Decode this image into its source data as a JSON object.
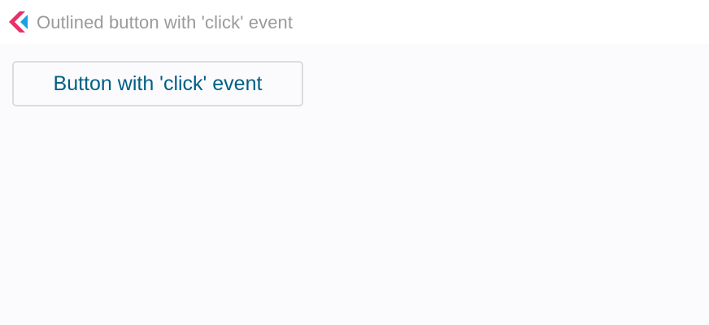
{
  "header": {
    "title": "Outlined button with 'click' event",
    "logo_icon": "app-logo-icon",
    "logo_colors": [
      "#e8316a",
      "#1aa1e0"
    ]
  },
  "main": {
    "button_label": "Button with 'click' event",
    "button_text_color": "#005f85",
    "button_border_color": "#dcdcdc"
  }
}
